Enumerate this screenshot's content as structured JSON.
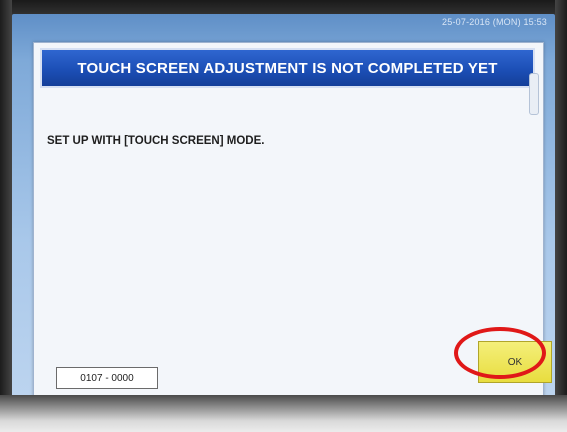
{
  "screen": {
    "datetime": "25-07-2016 (MON)  15:53"
  },
  "dialog": {
    "title": "TOUCH SCREEN ADJUSTMENT IS NOT COMPLETED YET",
    "message": "SET UP WITH [TOUCH SCREEN] MODE.",
    "code": "0107 - 0000",
    "ok_label": "OK"
  },
  "colors": {
    "header": "#1c4fb6",
    "ok_button": "#e8dd3f",
    "annotation": "#e01818"
  }
}
